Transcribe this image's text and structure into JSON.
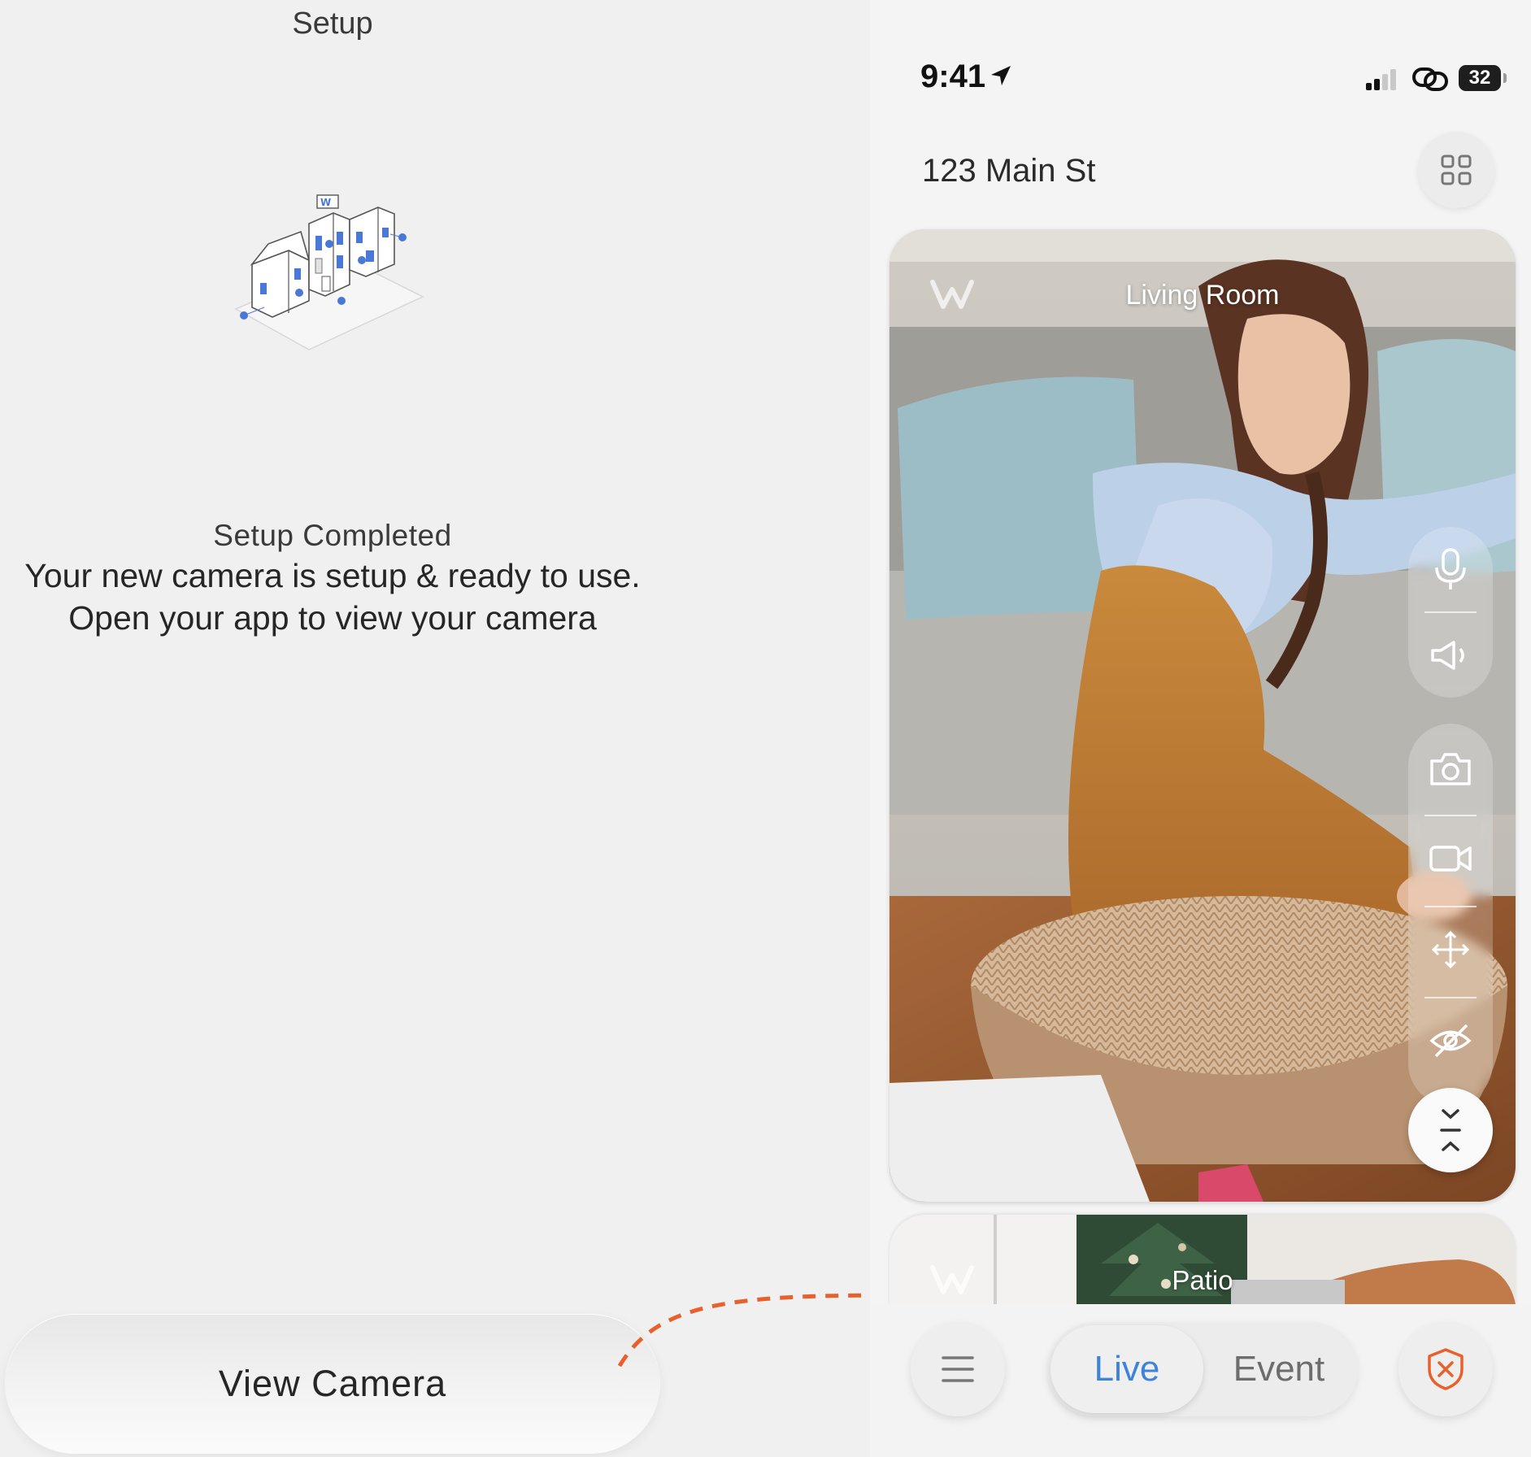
{
  "setup": {
    "title": "Setup",
    "completed_label": "Setup Completed",
    "message_line1": "Your new camera is setup & ready to use.",
    "message_line2": "Open your app to view your camera",
    "view_camera_label": "View Camera"
  },
  "phone": {
    "status_bar": {
      "time": "9:41",
      "battery": "32"
    },
    "address": "123 Main St",
    "cameras": [
      {
        "name": "Living Room"
      },
      {
        "name": "Patio"
      }
    ],
    "controls": [
      "microphone-icon",
      "speaker-icon",
      "camera-icon",
      "video-icon",
      "move-icon",
      "eye-off-icon",
      "collapse-icon"
    ],
    "tabs": {
      "live": "Live",
      "event": "Event",
      "active": "live"
    }
  },
  "colors": {
    "accent_blue": "#3f83d8",
    "arrow_orange": "#e8612c",
    "shield_orange": "#e8612c"
  }
}
